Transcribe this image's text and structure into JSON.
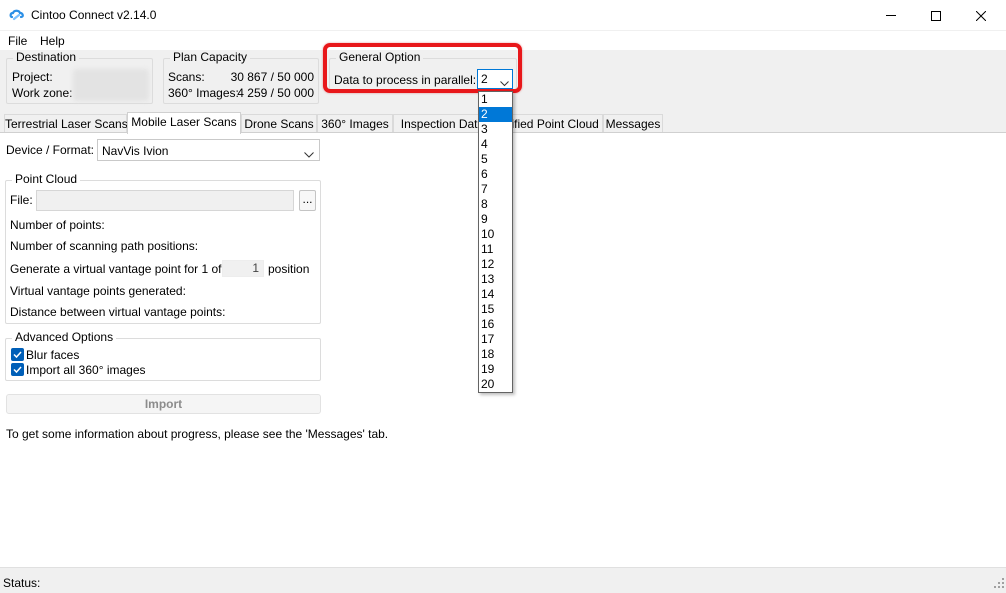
{
  "window": {
    "title": "Cintoo Connect v2.14.0"
  },
  "menu": [
    "File",
    "Help"
  ],
  "destination": {
    "title": "Destination",
    "project_label": "Project:",
    "workzone_label": "Work zone:"
  },
  "plan_capacity": {
    "title": "Plan Capacity",
    "scans_label": "Scans:",
    "scans_value": "30 867 / 50 000",
    "images_label": "360° Images:",
    "images_value": "4 259 / 50 000"
  },
  "general_option": {
    "title": "General Option",
    "parallel_label": "Data to process in parallel:",
    "parallel_value": "2",
    "options": [
      "1",
      "2",
      "3",
      "4",
      "5",
      "6",
      "7",
      "8",
      "9",
      "10",
      "11",
      "12",
      "13",
      "14",
      "15",
      "16",
      "17",
      "18",
      "19",
      "20"
    ],
    "highlight_color": "#e8171a"
  },
  "tabs": [
    {
      "label": "Terrestrial Laser Scans"
    },
    {
      "label": "Mobile Laser Scans"
    },
    {
      "label": "Drone Scans"
    },
    {
      "label": "360° Images"
    },
    {
      "label": "Inspection Data"
    },
    {
      "label": "Unified Point Cloud"
    },
    {
      "label": "Messages"
    }
  ],
  "device": {
    "label": "Device / Format:",
    "value": "NavVis Ivion"
  },
  "point_cloud": {
    "title": "Point Cloud",
    "file_label": "File:",
    "browse_label": "...",
    "num_points_label": "Number of points:",
    "num_path_label": "Number of scanning path positions:",
    "generate_label": "Generate a virtual vantage point for 1 of",
    "generate_value": "1",
    "position_label": "position",
    "generated_label": "Virtual vantage points generated:",
    "distance_label": "Distance between virtual vantage points:"
  },
  "advanced": {
    "title": "Advanced Options",
    "blur_label": "Blur faces",
    "import_images_label": "Import all 360° images"
  },
  "import_button": "Import",
  "info_text": "To get some information about progress, please see the 'Messages' tab.",
  "status_label": "Status:",
  "colors": {
    "accent": "#0078d7",
    "checkbox": "#005fb8"
  }
}
